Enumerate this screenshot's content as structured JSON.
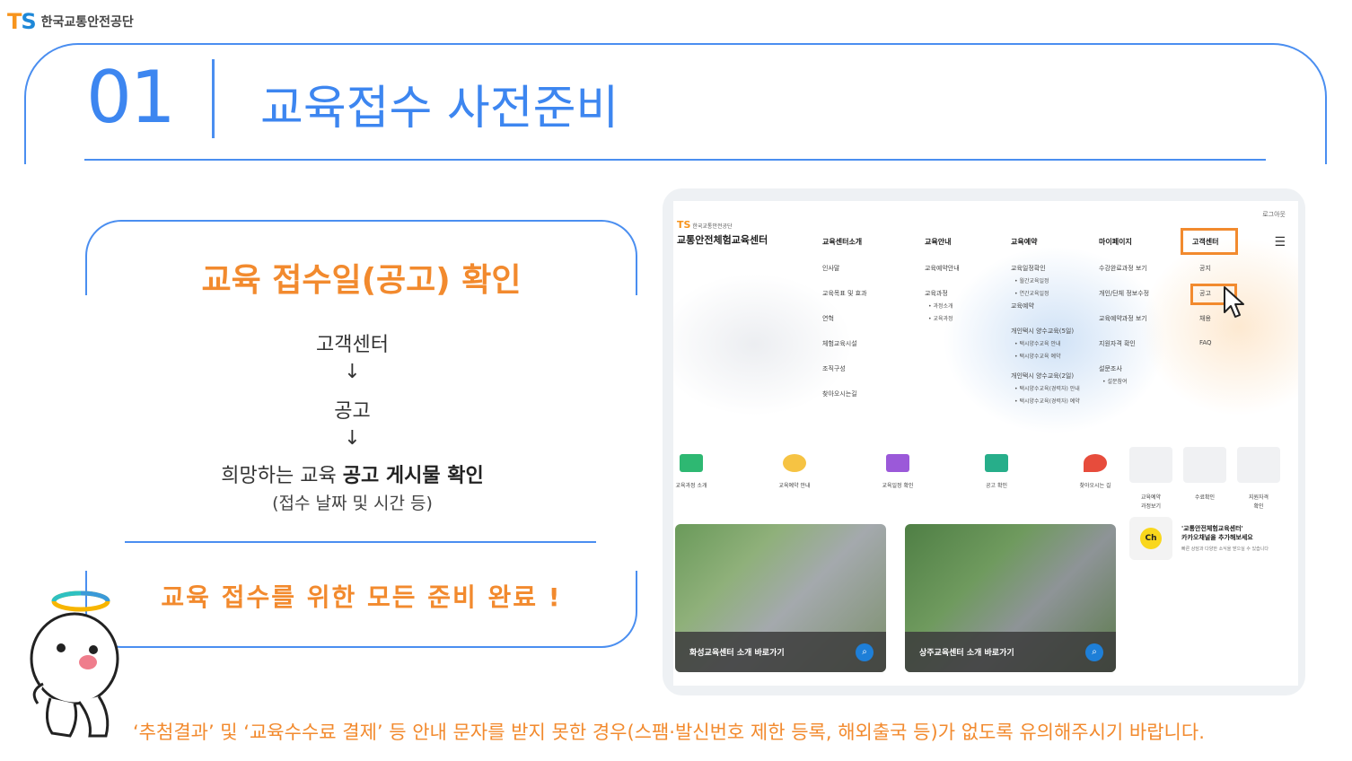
{
  "header": {
    "logo_mark_t": "T",
    "logo_mark_s": "S",
    "org_name": "한국교통안전공단"
  },
  "title": {
    "number": "01",
    "text": "교육접수 사전준비"
  },
  "card": {
    "heading": "교육 접수일(공고) 확인",
    "step1": "고객센터",
    "arrow": "↓",
    "step2": "공고",
    "step3_prefix": "희망하는 교육 ",
    "step3_strong": "공고 게시물 확인",
    "step3_sub": "(접수 날짜 및 시간 등)",
    "done": "교육 접수를 위한 모든 준비 완료 !"
  },
  "note": "‘추첨결과’ 및 ‘교육수수료 결제’ 등 안내 문자를 받지 못한 경우(스팸·발신번호 제한 등록, 해외출국 등)가 없도록 유의해주시기 바랍니다.",
  "screenshot": {
    "logout": "로그아웃",
    "brand_small": "한국교통안전공단",
    "brand_mark": "TS",
    "brand_big": "교통안전체험교육센터",
    "nav": [
      "교육센터소개",
      "교육안내",
      "교육예약",
      "마이페이지",
      "고객센터"
    ],
    "menu_intro": [
      "인사말",
      "교육목표 및 효과",
      "연혁",
      "체험교육시설",
      "조직구성",
      "찾아오시는길"
    ],
    "menu_guide": {
      "a": "교육예약안내",
      "b": "교육과정",
      "b1": "• 과정소개",
      "b2": "• 교육과정"
    },
    "menu_reserve": {
      "a": "교육일정확인",
      "a1": "• 월간교육일정",
      "a2": "• 연간교육일정",
      "b": "교육예약",
      "c": "개인택시 양수교육(5일)",
      "c1": "• 택시양수교육 안내",
      "c2": "• 택시양수교육 예약",
      "d": "개인택시 양수교육(2일)",
      "d1": "• 택시양수교육(경력자) 안내",
      "d2": "• 택시양수교육(경력자) 예약"
    },
    "menu_mypage": {
      "a": "수강완료과정 보기",
      "b": "개인/단체 정보수정",
      "c": "교육예약과정 보기",
      "d": "지원자격 확인",
      "e": "설문조사",
      "e1": "• 설문참여"
    },
    "menu_cs": [
      "공지",
      "공고",
      "채용",
      "FAQ"
    ],
    "quick": [
      "교육과정 소개",
      "교육예약 안내",
      "교육일정 확인",
      "공고 확인",
      "찾아오시는 길"
    ],
    "quick_gray": [
      "교육예약\n과정보기",
      "수료확인",
      "지원자격\n확인"
    ],
    "photos": [
      "화성교육센터 소개 바로가기",
      "상주교육센터 소개 바로가기"
    ],
    "kakao": {
      "ch": "Ch",
      "line1": "'교통안전체험교육센터'",
      "line2": "카카오채널을 추가해보세요",
      "line3": "빠른 상담과 다양한 소식을 받으실 수 있습니다"
    }
  }
}
